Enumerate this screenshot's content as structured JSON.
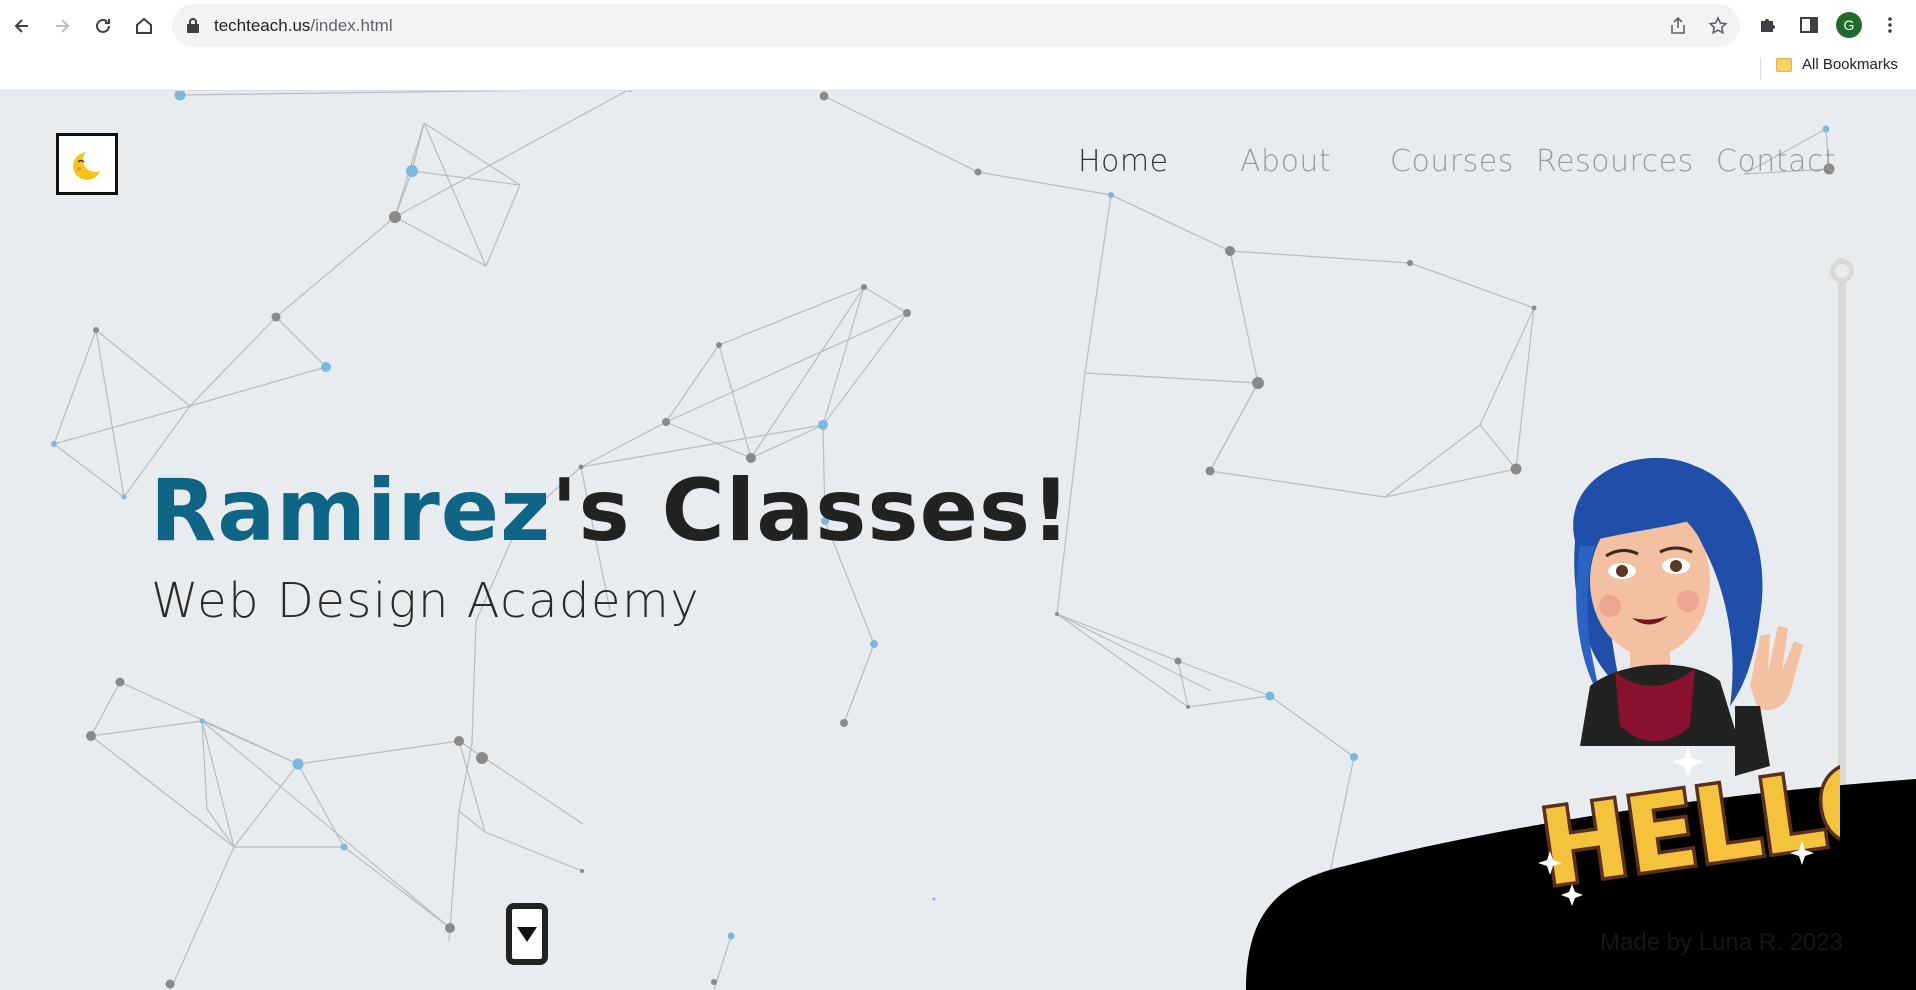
{
  "browser": {
    "url_host": "techteach.us",
    "url_path": "/index.html",
    "profile_initial": "G",
    "bookmarks_label": "All Bookmarks"
  },
  "site": {
    "nav": [
      "Home",
      "About",
      "Courses",
      "Resources",
      "Contact"
    ],
    "active_nav": "Home",
    "hero_title_name": "Ramirez",
    "hero_title_rest": "'s Classes!",
    "hero_subtitle": "Web Design Academy",
    "footer_credit": "Made by Luna R. 2023",
    "avatar_text": "HELLO"
  },
  "colors": {
    "accent": "#0e6586",
    "background": "#e9ecee",
    "node_blue": "#7ab8e0",
    "node_gray": "#8a8a8a"
  }
}
